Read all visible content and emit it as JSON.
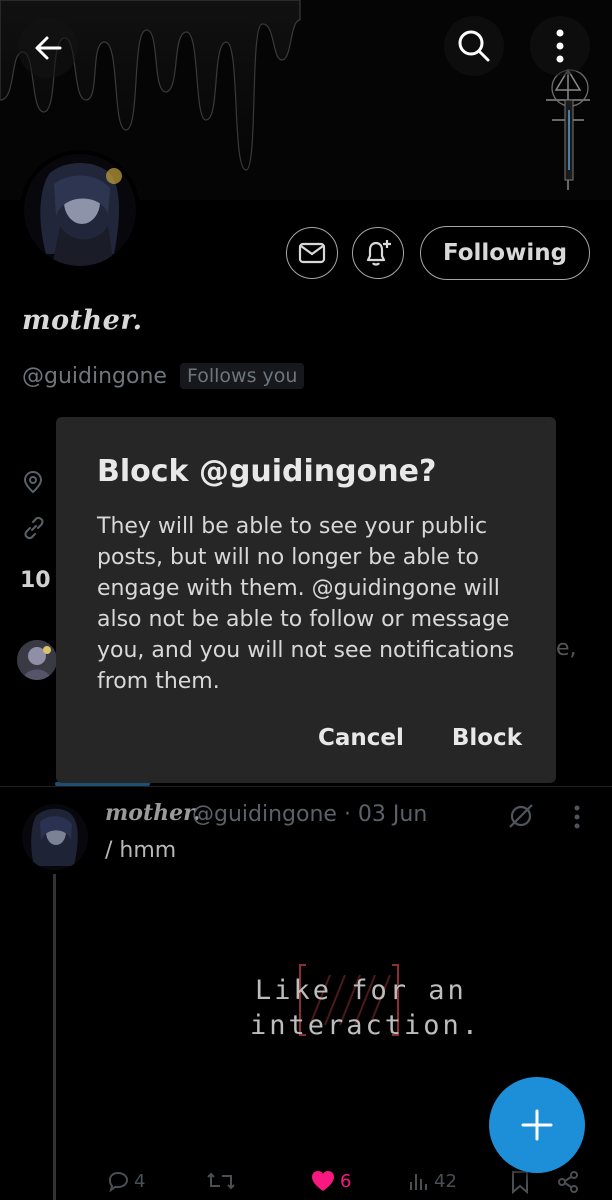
{
  "header": {
    "back_icon": "arrow-left-icon",
    "search_icon": "search-icon",
    "more_icon": "more-vertical-icon"
  },
  "profile": {
    "display_name": "mother.",
    "handle": "@guidingone",
    "follows_you": "Follows you",
    "following_label": "Following",
    "following_count": "10",
    "behind_text_fragment": "e,"
  },
  "dialog": {
    "title": "Block @guidingone?",
    "body": "They will be able to see your public posts, but will no longer be able to engage with them. @guidingone will also not be able to follow or message you, and you will not see notifications from them.",
    "cancel_label": "Cancel",
    "block_label": "Block"
  },
  "post": {
    "author_name": "mother.",
    "author_meta": "@guidingone · 03 Jun",
    "text": "/ hmm",
    "media_line1": "Like for an",
    "media_line2": "interaction.",
    "replies": "4",
    "reposts": "",
    "likes": "6",
    "views": "42"
  },
  "colors": {
    "accent": "#1d8fd8",
    "like": "#f91880",
    "dialog_bg": "#262626"
  }
}
